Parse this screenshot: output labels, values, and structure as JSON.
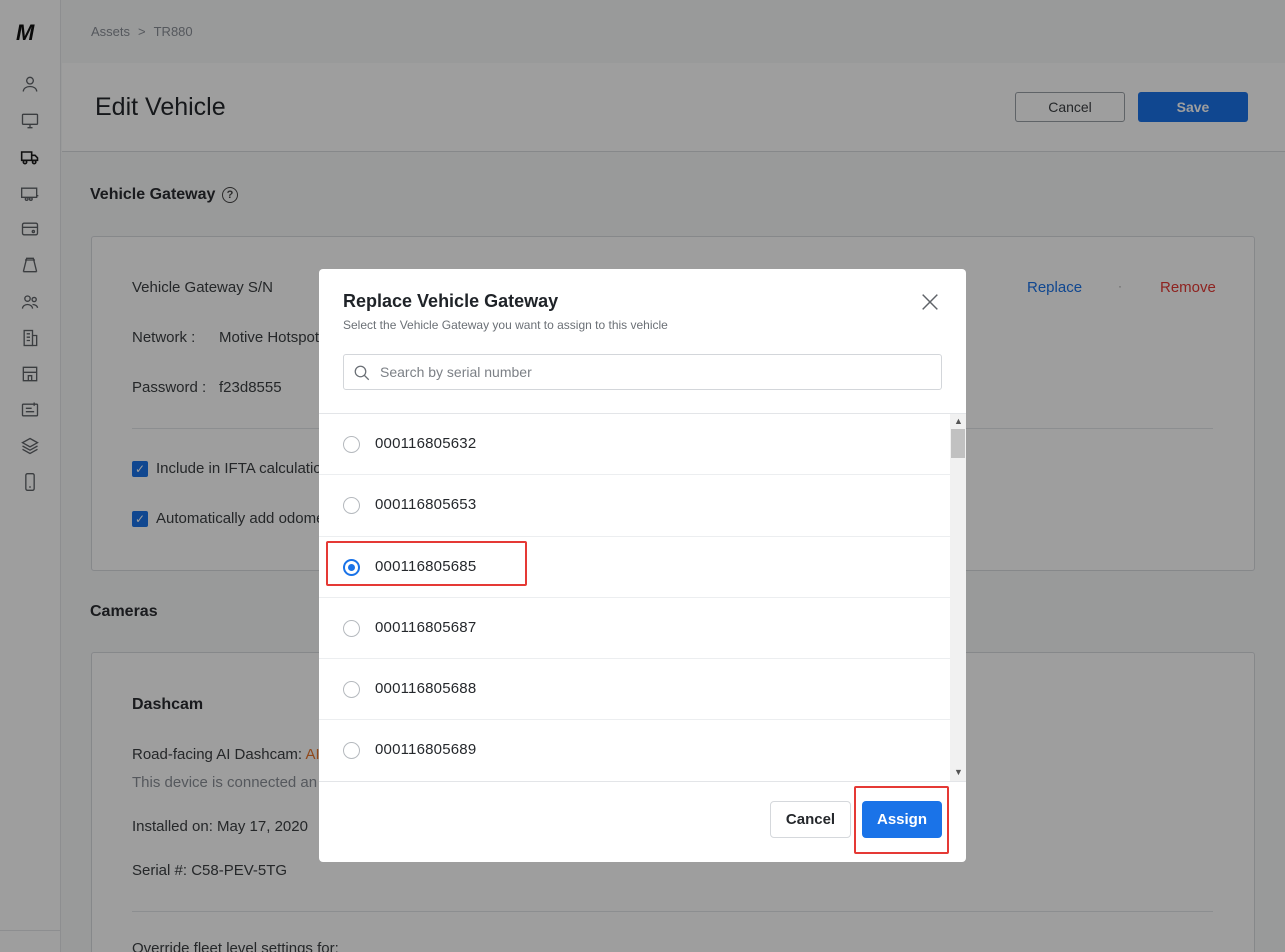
{
  "sidebar": {
    "logo": "M",
    "icons": [
      "user-icon",
      "monitor-icon",
      "truck-icon",
      "trailer-icon",
      "card-icon",
      "road-icon",
      "people-icon",
      "building-icon",
      "store-icon",
      "document-icon",
      "layers-icon",
      "phone-icon"
    ]
  },
  "breadcrumb": {
    "root": "Assets",
    "separator": ">",
    "current": "TR880"
  },
  "header": {
    "title": "Edit Vehicle",
    "cancel_label": "Cancel",
    "save_label": "Save"
  },
  "gateway_section": {
    "title": "Vehicle Gateway",
    "help": "?",
    "serial_label": "Vehicle Gateway S/N",
    "replace_label": "Replace",
    "separator": "·",
    "remove_label": "Remove",
    "network_label": "Network :",
    "network_value": "Motive Hotspot",
    "password_label": "Password :",
    "password_value": "f23d8555",
    "ifta_label": "Include in IFTA calculatio",
    "odometer_label": "Automatically add odome"
  },
  "cameras_section": {
    "title": "Cameras",
    "dashcam_title": "Dashcam",
    "road_facing_label": "Road-facing AI Dashcam:",
    "road_facing_value": "AI",
    "connected_text": "This device is connected an",
    "installed_text": "Installed on: May 17, 2020",
    "serial_text": "Serial #: C58-PEV-5TG",
    "override_text": "Override fleet level settings for:"
  },
  "modal": {
    "title": "Replace Vehicle Gateway",
    "subtitle": "Select the Vehicle Gateway you want to assign to this vehicle",
    "search_placeholder": "Search by serial number",
    "items": [
      {
        "serial": "000116805632",
        "selected": false
      },
      {
        "serial": "000116805653",
        "selected": false
      },
      {
        "serial": "000116805685",
        "selected": true
      },
      {
        "serial": "000116805687",
        "selected": false
      },
      {
        "serial": "000116805688",
        "selected": false
      },
      {
        "serial": "000116805689",
        "selected": false
      }
    ],
    "cancel_label": "Cancel",
    "assign_label": "Assign",
    "scroll_up": "▲",
    "scroll_down": "▼"
  },
  "colors": {
    "accent": "#1a73e8",
    "danger": "#e53935",
    "highlight": "#e53935"
  }
}
